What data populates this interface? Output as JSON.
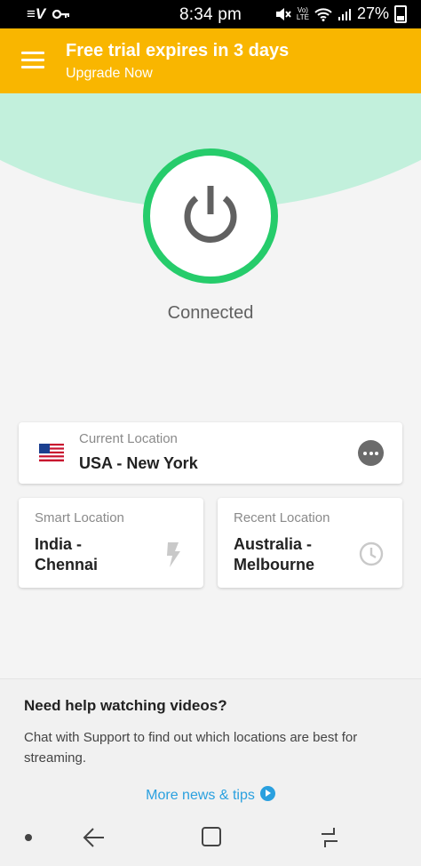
{
  "status_bar": {
    "time": "8:34 pm",
    "battery": "27%",
    "left_icons": [
      "expressvpn-icon",
      "vpn-key-icon"
    ],
    "right_icons": [
      "mute-icon",
      "volte-icon",
      "wifi-icon",
      "signal-icon",
      "battery-icon"
    ]
  },
  "banner": {
    "title": "Free trial expires in 3 days",
    "subtitle": "Upgrade Now",
    "color": "#f9b600"
  },
  "connection": {
    "status": "Connected",
    "ring_color": "#26cc6b",
    "hero_color": "#c2f0dc"
  },
  "current_location": {
    "label": "Current Location",
    "value": "USA - New York",
    "flag": "us-flag-icon"
  },
  "smart_location": {
    "label": "Smart Location",
    "value_line1": "India -",
    "value_line2": "Chennai"
  },
  "recent_location": {
    "label": "Recent Location",
    "value_line1": "Australia -",
    "value_line2": "Melbourne"
  },
  "news": {
    "title": "Need help watching videos?",
    "body": "Chat with Support to find out which locations are best for streaming.",
    "link": "More news & tips",
    "link_color": "#2aa0df"
  },
  "nav_bar": {
    "buttons": [
      "back-icon",
      "home-icon",
      "recents-icon"
    ]
  }
}
